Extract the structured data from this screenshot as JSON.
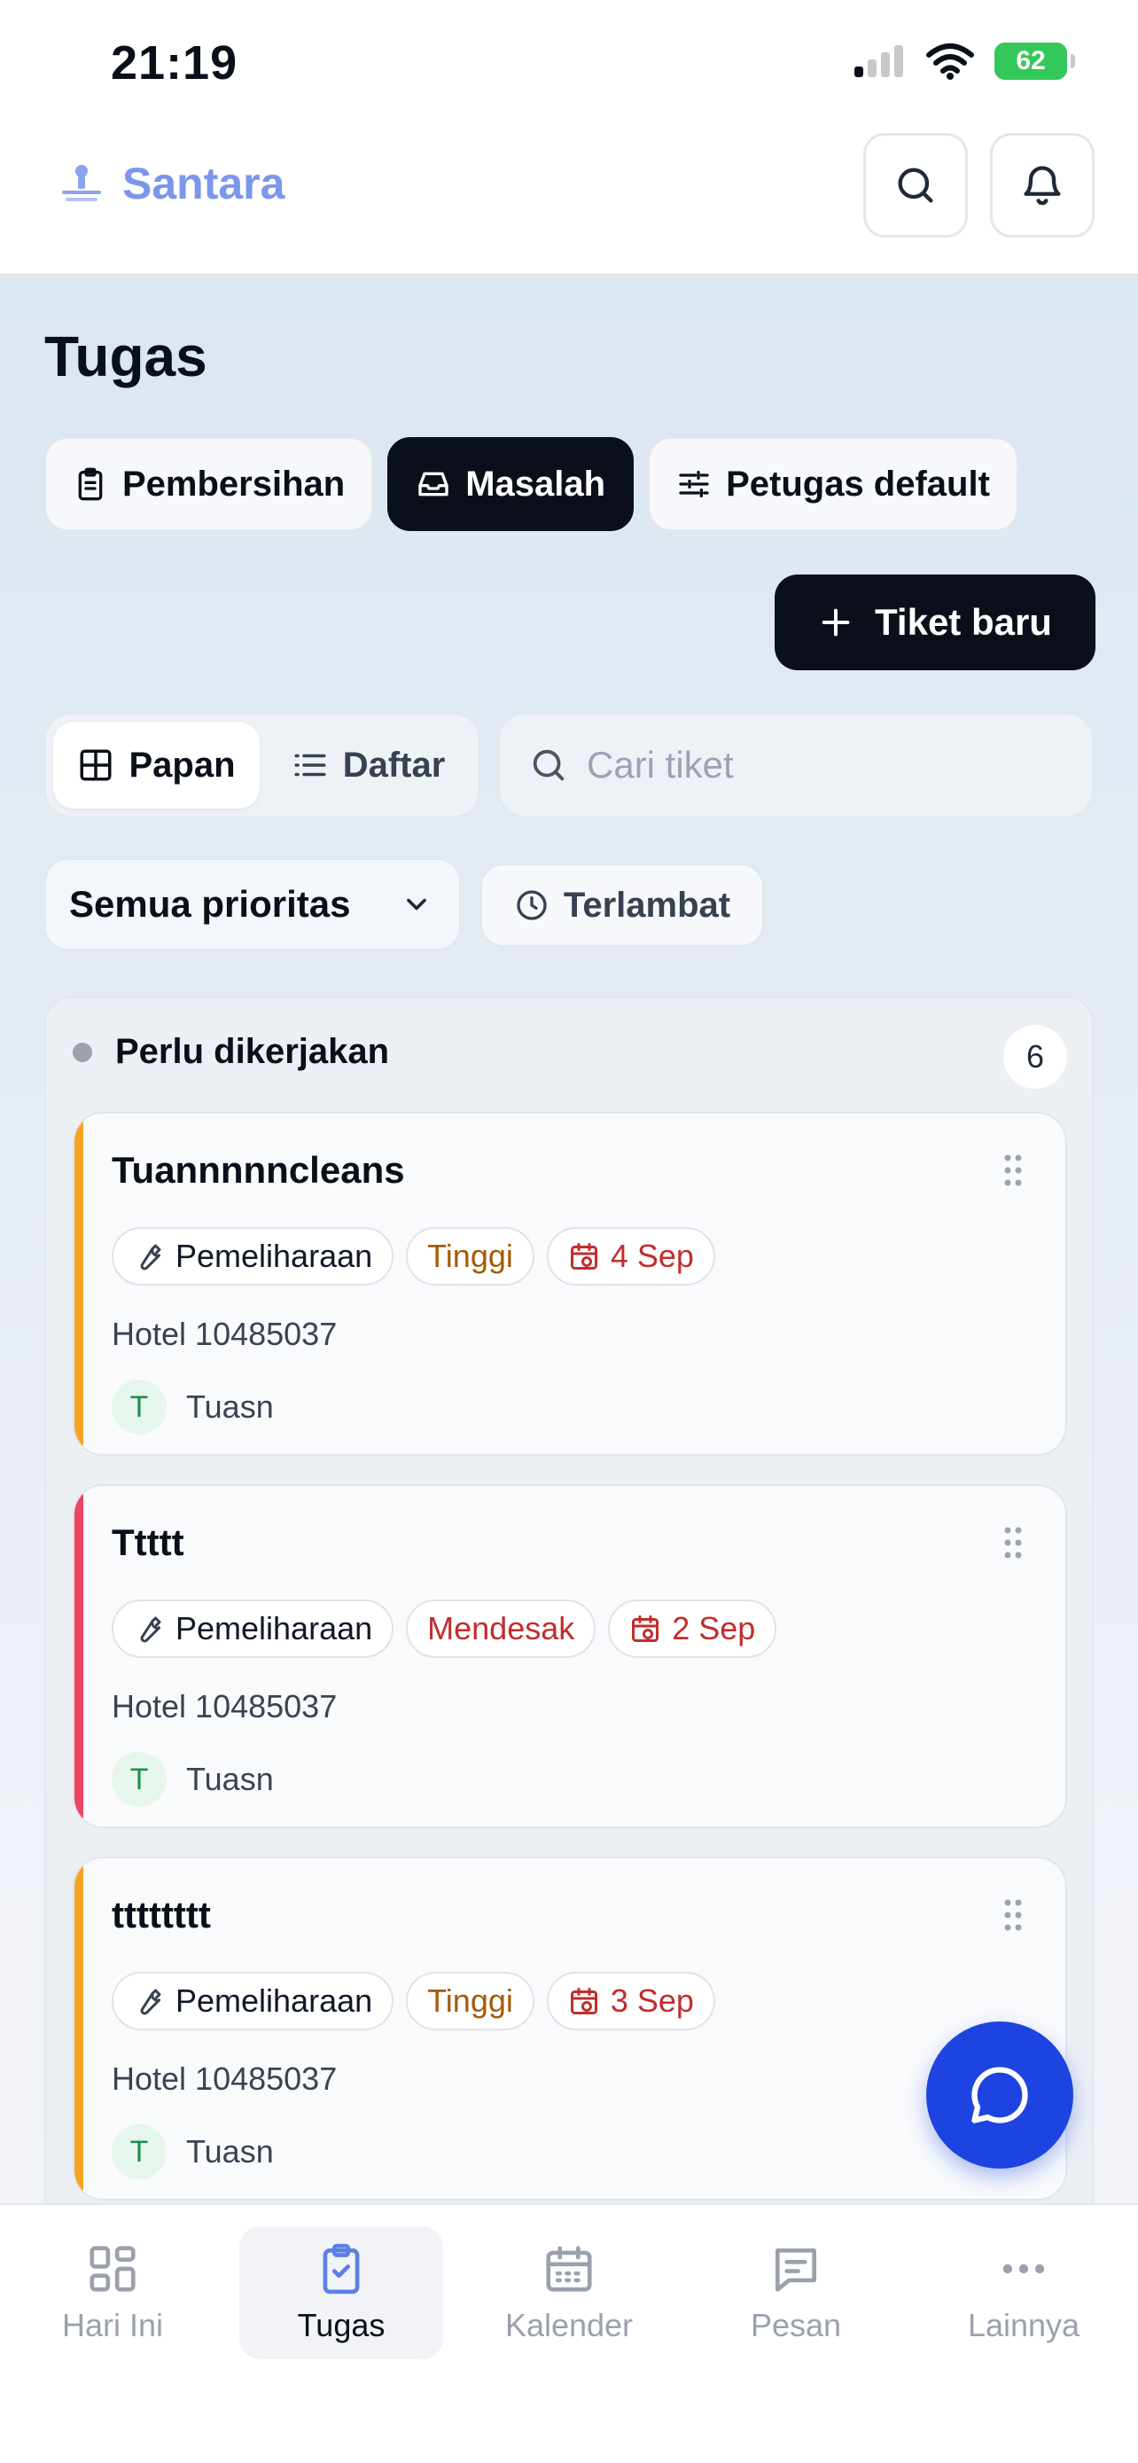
{
  "status_bar": {
    "time": "21:19",
    "battery": "62"
  },
  "header": {
    "brand": "Santara"
  },
  "page": {
    "title": "Tugas"
  },
  "tabs": [
    {
      "label": "Pembersihan",
      "icon": "clipboard-list-icon"
    },
    {
      "label": "Masalah",
      "icon": "inbox-icon",
      "active": true
    },
    {
      "label": "Petugas default",
      "icon": "sliders-icon"
    }
  ],
  "new_ticket": {
    "label": "Tiket baru"
  },
  "view_toggle": {
    "board": "Papan",
    "list": "Daftar"
  },
  "search": {
    "placeholder": "Cari tiket"
  },
  "filters": {
    "priority": "Semua prioritas",
    "late": "Terlambat"
  },
  "column": {
    "title": "Perlu dikerjakan",
    "count": "6",
    "cards": [
      {
        "title": "Tuannnnncleans",
        "category": "Pemeliharaan",
        "priority": "Tinggi",
        "due": "4 Sep",
        "location": "Hotel 10485037",
        "assignee_initial": "T",
        "assignee": "Tuasn",
        "accent": "#f5a524"
      },
      {
        "title": "Ttttt",
        "category": "Pemeliharaan",
        "priority": "Mendesak",
        "due": "2 Sep",
        "location": "Hotel 10485037",
        "assignee_initial": "T",
        "assignee": "Tuasn",
        "accent": "#ef4461"
      },
      {
        "title": "tttttttt",
        "category": "Pemeliharaan",
        "priority": "Tinggi",
        "due": "3 Sep",
        "location": "Hotel 10485037",
        "assignee_initial": "T",
        "assignee": "Tuasn",
        "accent": "#f5a524"
      }
    ]
  },
  "bottom_nav": [
    {
      "label": "Hari Ini",
      "icon": "grid-icon"
    },
    {
      "label": "Tugas",
      "icon": "clipboard-check-icon",
      "active": true
    },
    {
      "label": "Kalender",
      "icon": "calendar-icon"
    },
    {
      "label": "Pesan",
      "icon": "message-icon"
    },
    {
      "label": "Lainnya",
      "icon": "more-icon"
    }
  ]
}
